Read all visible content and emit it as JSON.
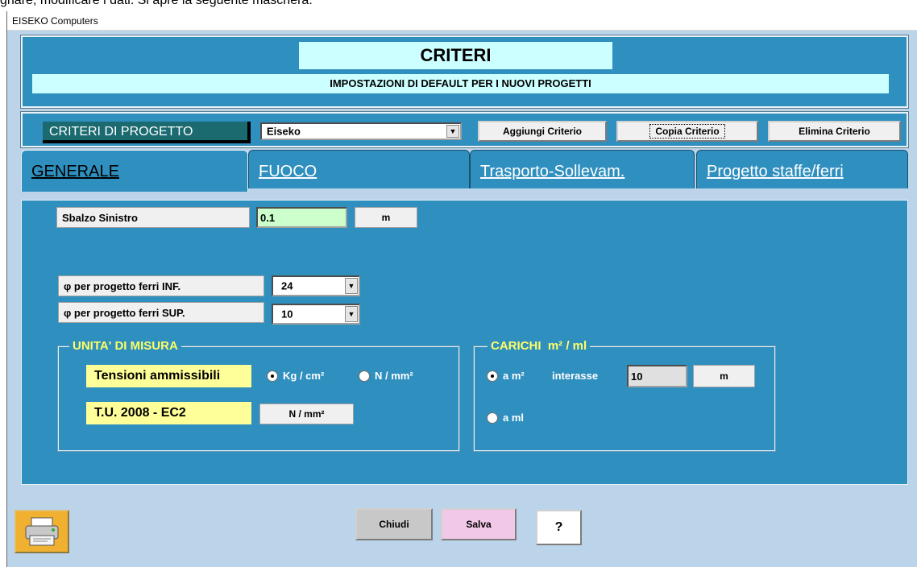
{
  "caption": "gnare, modificare i dati. Si apre la seguente maschera:",
  "window": {
    "title": "EISEKO Computers"
  },
  "header": {
    "title": "CRITERI",
    "subtitle": "IMPOSTAZIONI DI DEFAULT PER I NUOVI PROGETTI"
  },
  "criteria": {
    "label": "CRITERI DI PROGETTO",
    "selected": "Eiseko",
    "add_label": "Aggiungi Criterio",
    "copy_label": "Copia Criterio",
    "delete_label": "Elimina Criterio"
  },
  "tabs": [
    {
      "label": "GENERALE"
    },
    {
      "label": "FUOCO"
    },
    {
      "label": "Trasporto-Sollevam."
    },
    {
      "label": "Progetto staffe/ferri"
    }
  ],
  "general": {
    "sbalzo_label": "Sbalzo Sinistro",
    "sbalzo_value": "0.1",
    "sbalzo_unit": "m",
    "inf_label": "φ per progetto ferri INF.",
    "inf_value": "24",
    "sup_label": "φ per progetto ferri SUP.",
    "sup_value": "10"
  },
  "units_frame": {
    "title": "UNITA' DI MISURA",
    "tensioni_label": "Tensioni ammissibili",
    "opt_kg": "Kg / cm²",
    "opt_n": "N / mm²",
    "tu_label": "T.U. 2008 - EC2",
    "tu_unit": "N / mm²"
  },
  "loads_frame": {
    "title": "CARICHI  m² / ml",
    "opt_am2": "a m²",
    "interasse_label": "interasse",
    "interasse_value": "10",
    "interasse_unit": "m",
    "opt_aml": "a ml"
  },
  "footer": {
    "close_label": "Chiudi",
    "save_label": "Salva",
    "help_label": "?"
  },
  "colors": {
    "panel": "#2f8fbe",
    "title_bg": "#ccffff",
    "frame_title": "#ffff66",
    "salva_bg": "#f2c8e8",
    "chiudi_bg": "#c8c8c8",
    "green_input": "#ccffcc"
  },
  "icons": {
    "printer": "printer-icon"
  }
}
